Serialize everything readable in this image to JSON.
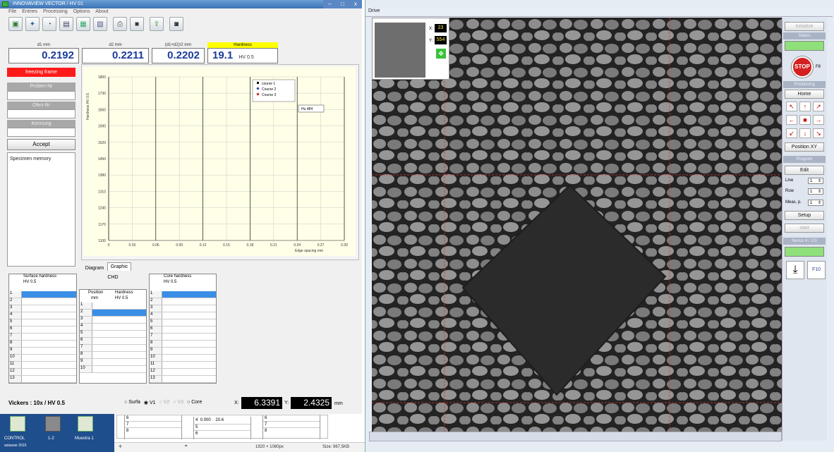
{
  "left_window": {
    "title": "INNOVAVIEW VECTOR / HV 01",
    "menu": [
      "File",
      "Entries",
      "Processing",
      "Options",
      "About"
    ],
    "measurements": {
      "d1_label": "d1 mm",
      "d1_value": "0.2192",
      "d2_label": "d2 mm",
      "d2_value": "0.2211",
      "avg_label": "(d1+d2)/2 mm",
      "avg_value": "0.2202",
      "hardness_label": "Hardness",
      "hardness_value": "19.1",
      "hardness_unit": "HV 0.5"
    },
    "sidebar": {
      "freeze_label": "freezing frame",
      "proben_label": "Proben-Nr",
      "ofen_label": "Ofen-Nr",
      "kennung_label": "Kennung",
      "accept_label": "Accept",
      "specimen_label": "Specimen memory"
    },
    "tabs": [
      "Diagram",
      "Graphic"
    ],
    "tables": {
      "surface_title": "Surface hardness",
      "surface_unit": "HV 0.5",
      "chd_title": "CHD",
      "chd_col1": "Position",
      "chd_col1_unit": "mm",
      "chd_col2": "Hardness",
      "chd_col2_unit": "HV 0.5",
      "core_title": "Core hardness",
      "core_unit": "HV 0.5",
      "row_numbers": [
        "1",
        "2",
        "3",
        "4",
        "5",
        "6",
        "7",
        "8",
        "9",
        "10",
        "11",
        "12",
        "13"
      ],
      "chd_row_numbers": [
        "1",
        "2",
        "3",
        "4",
        "5",
        "6",
        "7",
        "8",
        "9",
        "10"
      ]
    },
    "bottom": {
      "method": "Vickers : 10x / HV 0.5",
      "radio_surfa": "Surfa",
      "radio_v1": "V1",
      "radio_v2": "V2",
      "radio_v3": "V3",
      "radio_core": "Core",
      "x_label": "X:",
      "x_value": "6.3391",
      "y_label": "Y:",
      "y_value": "2.4325",
      "unit": "mm"
    },
    "behind_rows": {
      "nums_a": [
        "6",
        "7",
        "8"
      ],
      "nums_b": [
        "4",
        "5",
        "6"
      ],
      "nums_c": [
        "6",
        "7",
        "8"
      ],
      "row4_pos": "0.000",
      "row4_val": "20.6"
    }
  },
  "chart_data": {
    "type": "scatter",
    "ylabel": "Hardness HV 0.5",
    "xlabel": "Edge spacing  mm",
    "ylim": [
      1100,
      1800
    ],
    "xlim": [
      0,
      0.3
    ],
    "yticks": [
      "1800",
      "1730",
      "1660",
      "1590",
      "1520",
      "1450",
      "1380",
      "1310",
      "1240",
      "1170",
      "1100"
    ],
    "xticks": [
      "0",
      "0.03",
      "0.06",
      "0.09",
      "0.12",
      "0.15",
      "0.18",
      "0.21",
      "0.24",
      "0.27",
      "0.30"
    ],
    "legend": [
      "course 1",
      "Course 2",
      "Course 3"
    ],
    "legend_colors": [
      "#000000",
      "#1f3fb0",
      "#c02020"
    ],
    "annotation": "Hu   484",
    "grid": true,
    "legend_position": "top-right",
    "series": []
  },
  "drive_window": {
    "title": "Drive",
    "thumb_x_label": "X:",
    "thumb_x_value": "23",
    "thumb_y_label": "Y:",
    "thumb_y_value": "554"
  },
  "right_panel": {
    "init_label": "Initialize",
    "status_label": "Status",
    "stop_label": "STOP",
    "stop_key": "F8",
    "positioning_label": "Positioning",
    "home_label": "Home",
    "position_xy_label": "Position XY",
    "program_label": "Program",
    "edit_label": "Edit",
    "line_label": "Line",
    "line_value": "1",
    "row_label": "Row",
    "row_value": "1",
    "meas_label": "Meas. p.",
    "meas_value": "1",
    "setup_label": "Setup",
    "start_label": "start",
    "nexus_label": "Nexus 4 / 2/3",
    "f10_label": "F10",
    "status_color": "#8fe07a"
  },
  "taskbar": {
    "icons": [
      "CONTROL",
      "1-2",
      "Muestra 1"
    ],
    "sub": "aztasser 2015",
    "resolution": "1920 × 1080px",
    "size": "Size: 967,5KB"
  }
}
